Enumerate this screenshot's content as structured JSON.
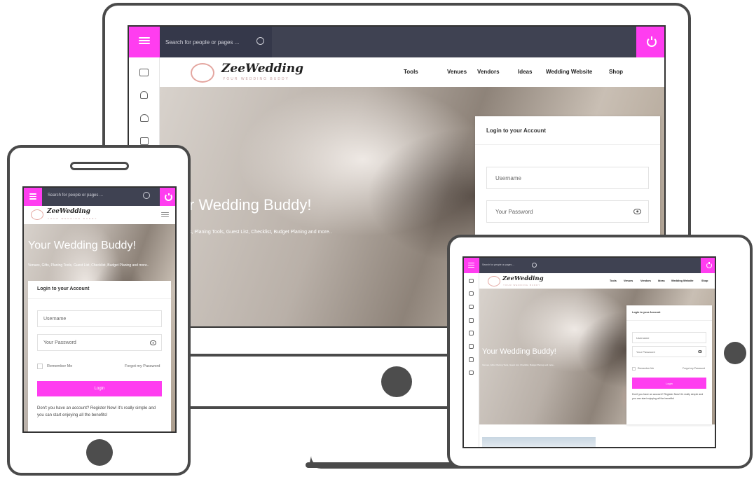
{
  "search_placeholder": "Search for people or pages ...",
  "logo": {
    "name": "ZeeWedding",
    "tagline": "YOUR WEDDING BUDDY"
  },
  "nav": [
    "Tools",
    "Venues",
    "Vendors",
    "Ideas",
    "Wedding Website",
    "Shop"
  ],
  "hero": {
    "title": "Your Wedding Buddy!",
    "desktop_title_fragment": "r Wedding Buddy!",
    "desktop_subtitle_fragment": "s, Planing Tools, Guest List, Checklist, Budget Planing and more..",
    "subtitle": "Venues, Gifts, Planing Tools, Guest List, Checklist, Budget Planing and more.."
  },
  "login": {
    "title": "Login to your Account",
    "username_placeholder": "Username",
    "password_placeholder": "Your Password",
    "remember": "Remember Me",
    "forgot": "Forgot my Password",
    "button": "Login",
    "register": "Don't you have an account? Register Now! it's really simple and you can start enjoying all the benefits!"
  },
  "colors": {
    "accent": "#ff3df0",
    "topbar": "#3f4252",
    "frame": "#4a4a4a"
  },
  "icons": [
    "menu-icon",
    "search-icon",
    "power-icon",
    "eye-icon",
    "sidebar-icon"
  ]
}
